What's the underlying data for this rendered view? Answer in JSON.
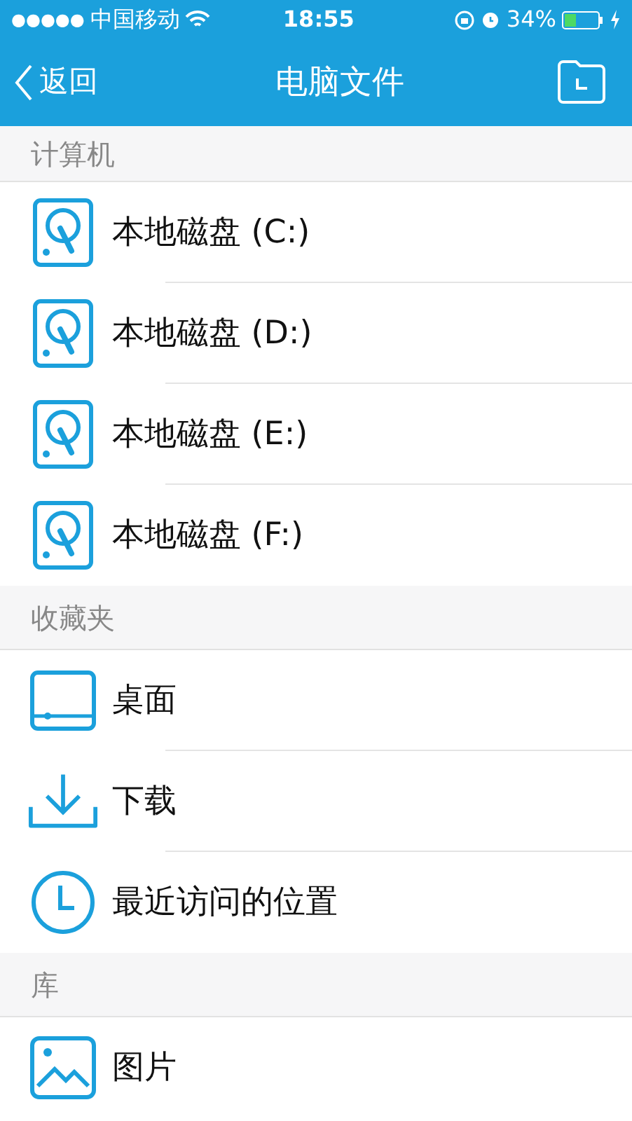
{
  "status_bar": {
    "signal_dots": "●●●●●",
    "carrier": "中国移动",
    "time": "18:55",
    "battery": "34%"
  },
  "nav": {
    "back": "返回",
    "title": "电脑文件"
  },
  "sections": [
    {
      "title": "计算机",
      "items": [
        {
          "kind": "disk",
          "label": "本地磁盘 (C:)"
        },
        {
          "kind": "disk",
          "label": "本地磁盘 (D:)"
        },
        {
          "kind": "disk",
          "label": "本地磁盘 (E:)"
        },
        {
          "kind": "disk",
          "label": "本地磁盘 (F:)"
        }
      ]
    },
    {
      "title": "收藏夹",
      "items": [
        {
          "kind": "desktop",
          "label": "桌面"
        },
        {
          "kind": "download",
          "label": "下载"
        },
        {
          "kind": "recent",
          "label": "最近访问的位置"
        }
      ]
    },
    {
      "title": "库",
      "items": [
        {
          "kind": "pictures",
          "label": "图片"
        }
      ]
    }
  ]
}
